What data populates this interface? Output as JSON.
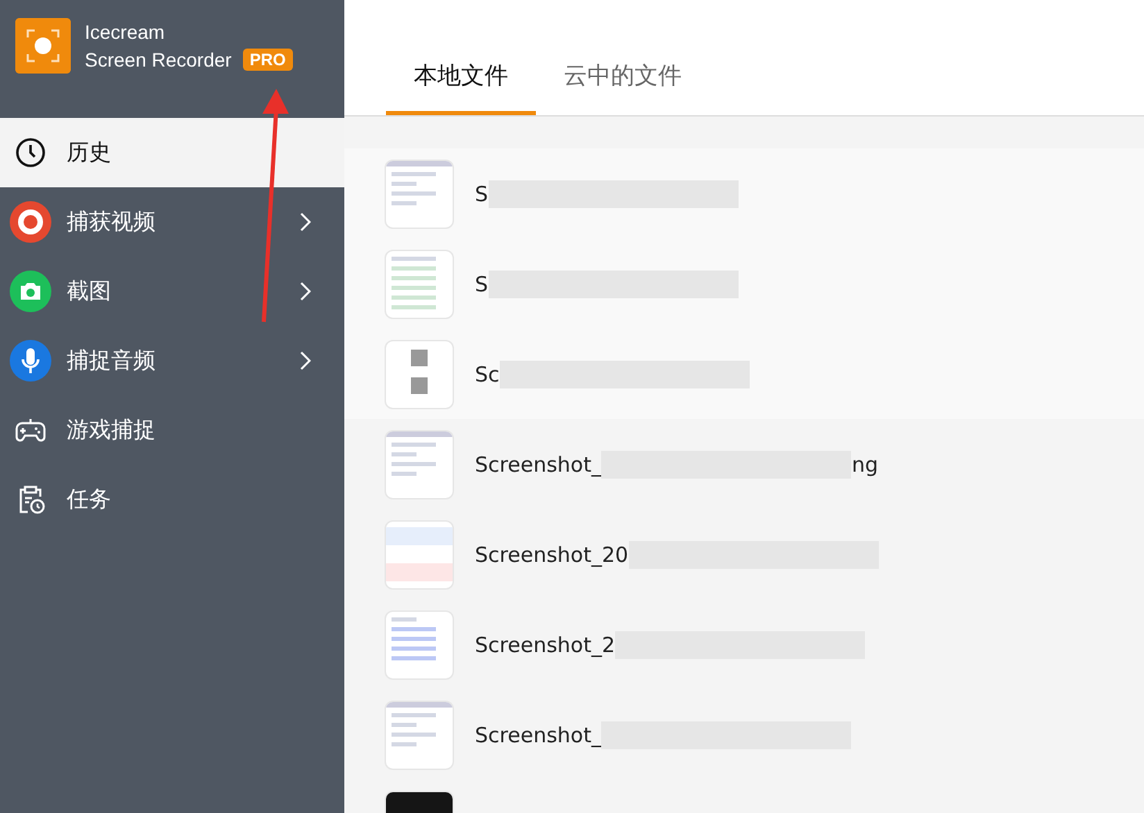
{
  "app": {
    "name_line1": "Icecream",
    "name_line2": "Screen Recorder",
    "badge": "PRO"
  },
  "sidebar": {
    "items": [
      {
        "label": "历史",
        "kind": "clock",
        "selected": true,
        "has_submenu": false
      },
      {
        "label": "捕获视频",
        "kind": "record",
        "selected": false,
        "has_submenu": true
      },
      {
        "label": "截图",
        "kind": "camera",
        "selected": false,
        "has_submenu": true
      },
      {
        "label": "捕捉音频",
        "kind": "mic",
        "selected": false,
        "has_submenu": true
      },
      {
        "label": "游戏捕捉",
        "kind": "gamepad",
        "selected": false,
        "has_submenu": false
      },
      {
        "label": "任务",
        "kind": "tasks",
        "selected": false,
        "has_submenu": false
      }
    ]
  },
  "tabs": [
    {
      "label": "本地文件",
      "selected": true
    },
    {
      "label": "云中的文件",
      "selected": false
    }
  ],
  "files": [
    {
      "name": "S",
      "kind": "page"
    },
    {
      "name": "S",
      "kind": "table"
    },
    {
      "name": "Sc",
      "kind": "text"
    },
    {
      "name": "Screenshot_",
      "suffix": "ng",
      "kind": "page"
    },
    {
      "name": "Screenshot_20",
      "kind": "bands"
    },
    {
      "name": "Screenshot_2",
      "kind": "list"
    },
    {
      "name": "Screenshot_",
      "kind": "page"
    },
    {
      "kind": "dark"
    }
  ]
}
